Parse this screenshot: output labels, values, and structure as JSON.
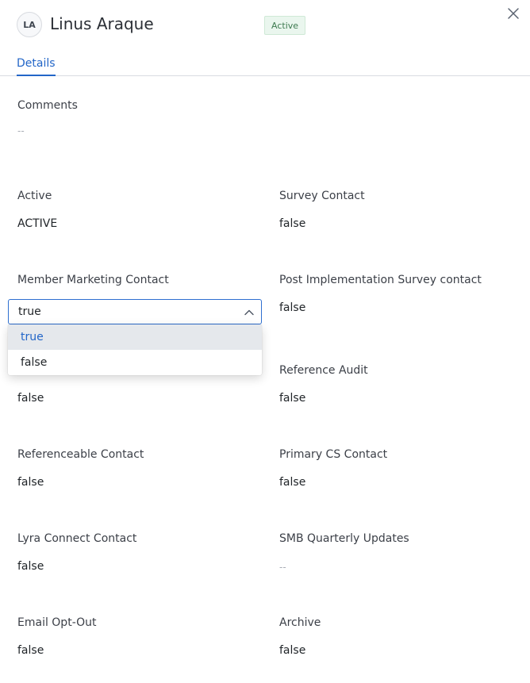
{
  "header": {
    "avatar_initials": "LA",
    "contact_name": "Linus Araque",
    "status_badge": "Active"
  },
  "tabs": [
    {
      "label": "Details",
      "active": true
    }
  ],
  "fields": {
    "comments": {
      "label": "Comments",
      "value": "--"
    },
    "active": {
      "label": "Active",
      "value": "ACTIVE"
    },
    "survey_contact": {
      "label": "Survey Contact",
      "value": "false"
    },
    "member_marketing_contact": {
      "label": "Member Marketing Contact",
      "value": "true",
      "options": [
        "true",
        "false"
      ],
      "selected_option": "true"
    },
    "post_implementation_survey_contact": {
      "label": "Post Implementation Survey contact",
      "value": "false"
    },
    "hidden_field_value": "false",
    "reference_audit": {
      "label": "Reference Audit",
      "value": "false"
    },
    "referenceable_contact": {
      "label": "Referenceable Contact",
      "value": "false"
    },
    "primary_cs_contact": {
      "label": "Primary CS Contact",
      "value": "false"
    },
    "lyra_connect_contact": {
      "label": "Lyra Connect Contact",
      "value": "false"
    },
    "smb_quarterly_updates": {
      "label": "SMB Quarterly Updates",
      "value": "--"
    },
    "email_opt_out": {
      "label": "Email Opt-Out",
      "value": "false"
    },
    "archive": {
      "label": "Archive",
      "value": "false"
    }
  },
  "colors": {
    "accent": "#2366c8",
    "badge_bg": "#eaf6ee",
    "badge_text": "#3d7a4f",
    "selected_option_bg": "#e5e8ec"
  },
  "icons": {
    "close": "close-icon",
    "select_toggle": "chevron-up-icon"
  }
}
